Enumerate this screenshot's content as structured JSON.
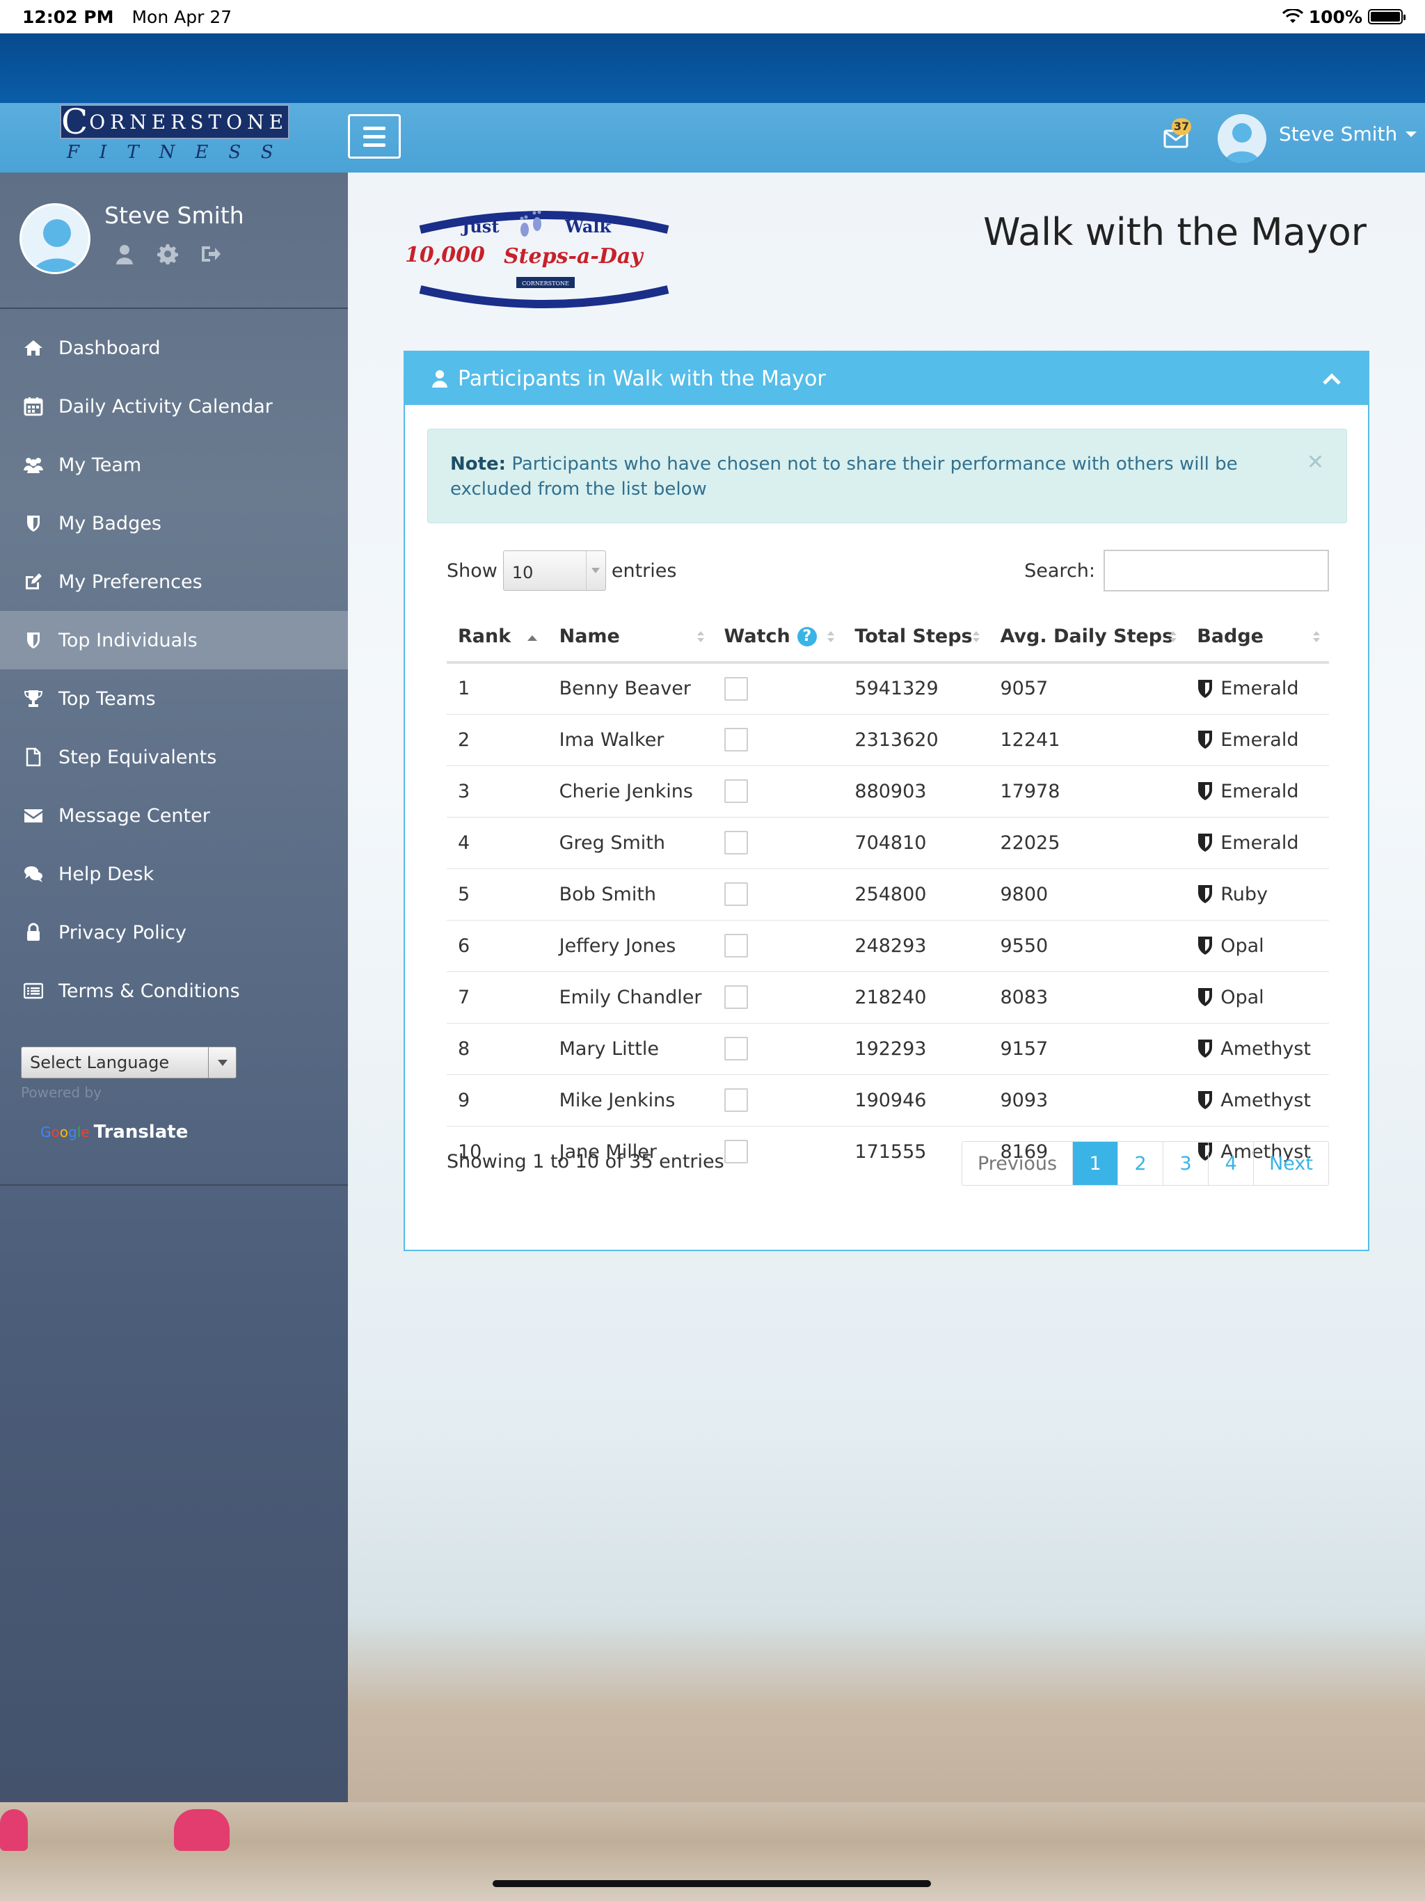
{
  "status_bar": {
    "time": "12:02 PM",
    "date": "Mon Apr 27",
    "battery": "100%"
  },
  "brand": {
    "logo_top_initial": "C",
    "logo_top_rest": "ORNERSTONE",
    "logo_bottom": "FITNESS"
  },
  "navbar": {
    "mail_count": "37",
    "user_name": "Steve Smith"
  },
  "sidebar": {
    "user_name": "Steve Smith",
    "items": [
      {
        "label": "Dashboard",
        "icon": "home-icon"
      },
      {
        "label": "Daily Activity Calendar",
        "icon": "calendar-icon"
      },
      {
        "label": "My Team",
        "icon": "users-icon"
      },
      {
        "label": "My Badges",
        "icon": "shield-icon"
      },
      {
        "label": "My Preferences",
        "icon": "edit-icon"
      },
      {
        "label": "Top Individuals",
        "icon": "shield-icon",
        "active": true
      },
      {
        "label": "Top Teams",
        "icon": "trophy-icon"
      },
      {
        "label": "Step Equivalents",
        "icon": "document-icon"
      },
      {
        "label": "Message Center",
        "icon": "envelope-icon"
      },
      {
        "label": "Help Desk",
        "icon": "chat-icon"
      },
      {
        "label": "Privacy Policy",
        "icon": "lock-icon"
      },
      {
        "label": "Terms & Conditions",
        "icon": "list-icon"
      }
    ],
    "language_select": "Select Language",
    "powered_by": "Powered by",
    "google": "Google",
    "translate": "Translate"
  },
  "event_logo": {
    "just": "Just",
    "walk": "Walk",
    "tagline_number": "10,000",
    "tagline_script": "Steps-a-Day",
    "sponsor": "CORNERSTONE"
  },
  "page": {
    "title": "Walk with the Mayor"
  },
  "panel": {
    "title": "Participants in Walk with the Mayor",
    "note_label": "Note:",
    "note_text": " Participants who have chosen not to share their performance with others will be excluded from the list below",
    "show_label": "Show",
    "show_value": "10",
    "entries_label": "entries",
    "search_label": "Search:",
    "search_value": ""
  },
  "table": {
    "headers": [
      "Rank",
      "Name",
      "Watch",
      "Total Steps",
      "Avg. Daily Steps",
      "Badge"
    ],
    "help_glyph": "?",
    "rows": [
      {
        "rank": "1",
        "name": "Benny Beaver",
        "total": "5941329",
        "avg": "9057",
        "badge": "Emerald"
      },
      {
        "rank": "2",
        "name": "Ima Walker",
        "total": "2313620",
        "avg": "12241",
        "badge": "Emerald"
      },
      {
        "rank": "3",
        "name": "Cherie Jenkins",
        "total": "880903",
        "avg": "17978",
        "badge": "Emerald"
      },
      {
        "rank": "4",
        "name": "Greg Smith",
        "total": "704810",
        "avg": "22025",
        "badge": "Emerald"
      },
      {
        "rank": "5",
        "name": "Bob Smith",
        "total": "254800",
        "avg": "9800",
        "badge": "Ruby"
      },
      {
        "rank": "6",
        "name": "Jeffery Jones",
        "total": "248293",
        "avg": "9550",
        "badge": "Opal"
      },
      {
        "rank": "7",
        "name": "Emily Chandler",
        "total": "218240",
        "avg": "8083",
        "badge": "Opal"
      },
      {
        "rank": "8",
        "name": "Mary Little",
        "total": "192293",
        "avg": "9157",
        "badge": "Amethyst"
      },
      {
        "rank": "9",
        "name": "Mike Jenkins",
        "total": "190946",
        "avg": "9093",
        "badge": "Amethyst"
      },
      {
        "rank": "10",
        "name": "Jane Miller",
        "total": "171555",
        "avg": "8169",
        "badge": "Amethyst"
      }
    ],
    "info": "Showing 1 to 10 of 35 entries",
    "pagination": {
      "previous": "Previous",
      "pages": [
        "1",
        "2",
        "3",
        "4"
      ],
      "current": "1",
      "next": "Next"
    }
  },
  "colors": {
    "accent": "#55bde9",
    "navbar": "#4aa2d6",
    "brand_dark": "#17306a",
    "link": "#3ab3e6"
  }
}
